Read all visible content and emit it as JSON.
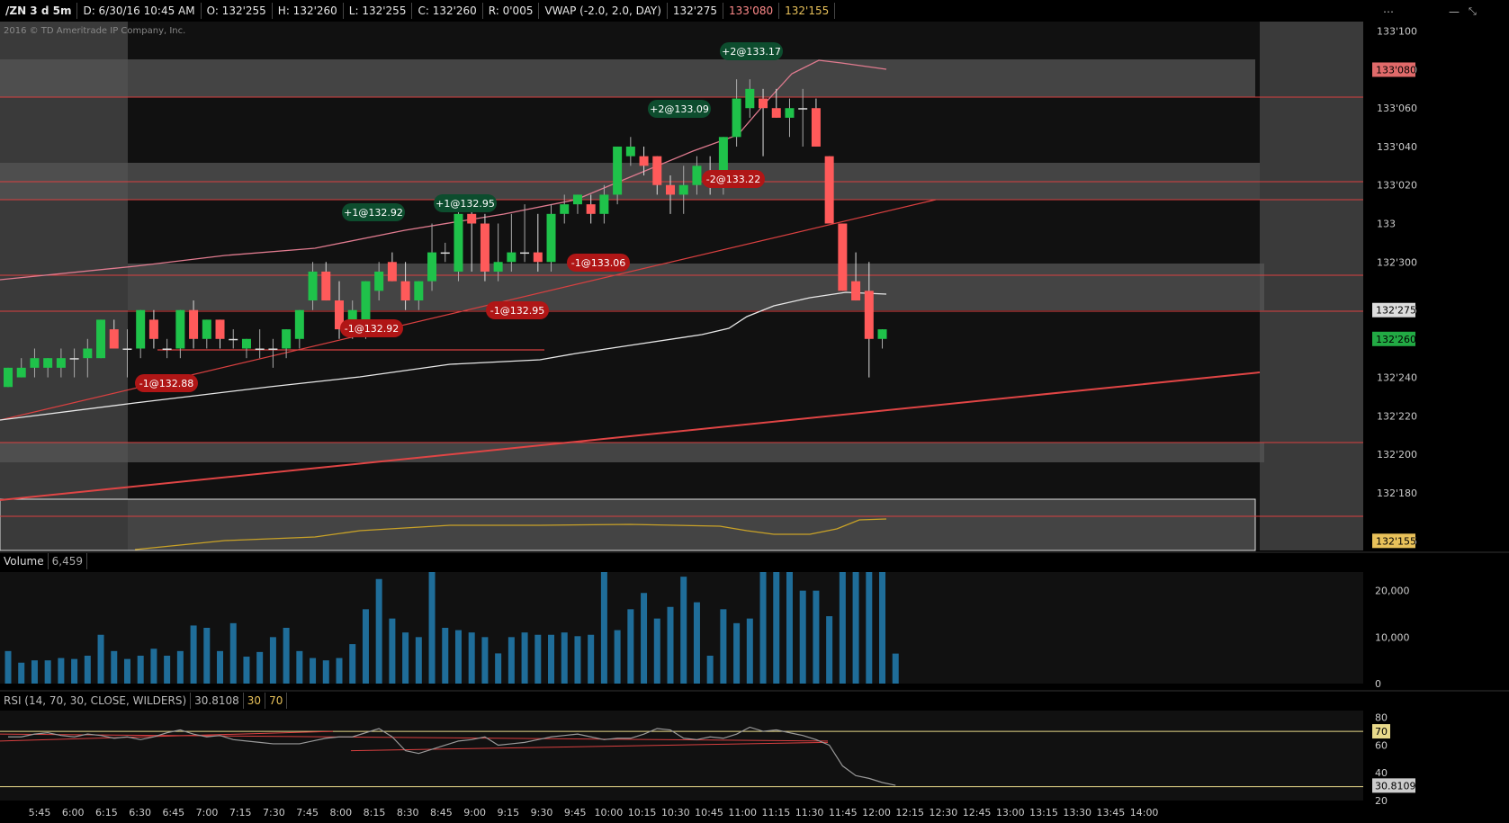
{
  "header": {
    "symbol": "/ZN 3 d 5m",
    "date": "D: 6/30/16 10:45 AM",
    "open": "O: 132'255",
    "high": "H: 132'260",
    "low": "L: 132'255",
    "close": "C: 132'260",
    "range": "R: 0'005",
    "vwap": "VWAP (-2.0, 2.0, DAY)",
    "vwap_mid": "132'275",
    "vwap_upper": "133'080",
    "vwap_lower": "132'155"
  },
  "copyright": "2016 © TD Ameritrade IP Company, Inc.",
  "chart_data": [
    {
      "type": "candlestick",
      "ylim": [
        132.15,
        133.105
      ],
      "price_axis_labels": [
        "133'100",
        "133'080",
        "133'060",
        "133'040",
        "133'020",
        "133",
        "132'300",
        "132'275",
        "132'240",
        "132'220",
        "132'200",
        "132'180",
        "132'155"
      ],
      "price_axis_values": [
        133.1,
        133.08,
        133.06,
        133.04,
        133.02,
        133.0,
        132.3,
        132.275,
        132.24,
        132.22,
        132.2,
        132.18,
        132.155
      ],
      "highlighted_price_labels": [
        {
          "label": "133'080",
          "value": 133.08,
          "color": "#e06a6a"
        },
        {
          "label": "132'275",
          "value": 132.275,
          "color": "#dddddd"
        },
        {
          "label": "132'260",
          "value": 132.26,
          "color": "#22aa44"
        },
        {
          "label": "132'155",
          "value": 132.155,
          "color": "#e8c15a"
        }
      ],
      "time_labels": [
        "5:45",
        "6:00",
        "6:15",
        "6:30",
        "6:45",
        "7:00",
        "7:15",
        "7:30",
        "7:45",
        "8:00",
        "8:15",
        "8:30",
        "8:45",
        "9:00",
        "9:15",
        "9:30",
        "9:45",
        "10:00",
        "10:15",
        "10:30",
        "10:45",
        "11:00",
        "11:15",
        "11:30",
        "11:45",
        "12:00",
        "12:15",
        "12:30",
        "12:45",
        "13:00",
        "13:15",
        "13:30",
        "13:45",
        "14:00"
      ],
      "candles": [
        [
          132.235,
          132.245,
          132.235,
          132.245
        ],
        [
          132.24,
          132.25,
          132.24,
          132.245
        ],
        [
          132.245,
          132.255,
          132.24,
          132.25
        ],
        [
          132.245,
          132.25,
          132.24,
          132.25
        ],
        [
          132.245,
          132.255,
          132.24,
          132.25
        ],
        [
          132.25,
          132.255,
          132.24,
          132.25
        ],
        [
          132.25,
          132.26,
          132.24,
          132.255
        ],
        [
          132.25,
          132.27,
          132.25,
          132.27
        ],
        [
          132.265,
          132.27,
          132.255,
          132.255
        ],
        [
          132.255,
          132.265,
          132.24,
          132.255
        ],
        [
          132.255,
          132.275,
          132.25,
          132.275
        ],
        [
          132.27,
          132.275,
          132.255,
          132.26
        ],
        [
          132.255,
          132.26,
          132.25,
          132.255
        ],
        [
          132.255,
          132.275,
          132.25,
          132.275
        ],
        [
          132.275,
          132.28,
          132.255,
          132.26
        ],
        [
          132.26,
          132.27,
          132.255,
          132.27
        ],
        [
          132.27,
          132.27,
          132.255,
          132.26
        ],
        [
          132.26,
          132.265,
          132.255,
          132.26
        ],
        [
          132.255,
          132.26,
          132.25,
          132.26
        ],
        [
          132.255,
          132.265,
          132.25,
          132.255
        ],
        [
          132.255,
          132.26,
          132.245,
          132.255
        ],
        [
          132.255,
          132.265,
          132.25,
          132.265
        ],
        [
          132.26,
          132.275,
          132.255,
          132.275
        ],
        [
          132.28,
          132.3,
          132.275,
          132.295
        ],
        [
          132.295,
          132.3,
          132.28,
          132.28
        ],
        [
          132.28,
          132.29,
          132.26,
          132.265
        ],
        [
          132.265,
          132.28,
          132.26,
          132.275
        ],
        [
          132.265,
          132.29,
          132.26,
          132.29
        ],
        [
          132.285,
          132.3,
          132.28,
          132.295
        ],
        [
          132.3,
          132.305,
          132.29,
          132.29
        ],
        [
          132.29,
          132.3,
          132.275,
          132.28
        ],
        [
          132.28,
          132.29,
          132.275,
          132.29
        ],
        [
          132.29,
          133.0,
          132.285,
          132.305
        ],
        [
          132.305,
          132.31,
          132.3,
          132.305
        ],
        [
          132.295,
          133.01,
          132.29,
          133.005
        ],
        [
          133.005,
          133.01,
          132.295,
          133.0
        ],
        [
          133.0,
          133.005,
          132.29,
          132.295
        ],
        [
          132.295,
          133.0,
          132.29,
          132.3
        ],
        [
          132.3,
          133.005,
          132.295,
          132.305
        ],
        [
          132.305,
          133.01,
          132.3,
          132.305
        ],
        [
          132.305,
          133.005,
          132.295,
          132.3
        ],
        [
          132.3,
          133.01,
          132.295,
          133.005
        ],
        [
          133.005,
          133.015,
          133.0,
          133.01
        ],
        [
          133.01,
          133.015,
          133.005,
          133.015
        ],
        [
          133.01,
          133.015,
          133.0,
          133.005
        ],
        [
          133.005,
          133.02,
          133.0,
          133.015
        ],
        [
          133.015,
          133.04,
          133.01,
          133.04
        ],
        [
          133.035,
          133.045,
          133.03,
          133.04
        ],
        [
          133.035,
          133.04,
          133.025,
          133.03
        ],
        [
          133.035,
          133.035,
          133.015,
          133.02
        ],
        [
          133.02,
          133.025,
          133.005,
          133.015
        ],
        [
          133.015,
          133.03,
          133.005,
          133.02
        ],
        [
          133.02,
          133.035,
          133.015,
          133.03
        ],
        [
          133.025,
          133.035,
          133.015,
          133.02
        ],
        [
          133.02,
          133.045,
          133.015,
          133.045
        ],
        [
          133.045,
          133.075,
          133.04,
          133.065
        ],
        [
          133.06,
          133.075,
          133.055,
          133.07
        ],
        [
          133.065,
          133.07,
          133.035,
          133.06
        ],
        [
          133.06,
          133.07,
          133.055,
          133.055
        ],
        [
          133.055,
          133.065,
          133.045,
          133.06
        ],
        [
          133.06,
          133.07,
          133.04,
          133.06
        ],
        [
          133.06,
          133.065,
          133.04,
          133.04
        ],
        [
          133.035,
          133.035,
          133.0,
          133.0
        ],
        [
          133.0,
          133.0,
          132.285,
          132.285
        ],
        [
          132.29,
          132.305,
          132.28,
          132.28
        ],
        [
          132.285,
          132.3,
          132.24,
          132.26
        ],
        [
          132.26,
          132.265,
          132.255,
          132.265
        ]
      ],
      "trades": [
        {
          "label": "-1@132.88",
          "side": "sell"
        },
        {
          "label": "-1@132.92",
          "side": "sell"
        },
        {
          "label": "+1@132.92",
          "side": "buy"
        },
        {
          "label": "+1@132.95",
          "side": "buy"
        },
        {
          "label": "-1@132.95",
          "side": "sell"
        },
        {
          "label": "-1@133.06",
          "side": "sell"
        },
        {
          "label": "+2@133.09",
          "side": "buy"
        },
        {
          "label": "-2@133.22",
          "side": "sell"
        },
        {
          "label": "+2@133.17",
          "side": "buy"
        }
      ]
    },
    {
      "type": "bar",
      "title": "Volume",
      "last_value": "6,459",
      "ylim": [
        0,
        24000
      ],
      "axis_labels": [
        "20,000",
        "10,000",
        "0"
      ],
      "values": [
        7000,
        4500,
        5000,
        5000,
        5500,
        5300,
        6000,
        10500,
        7000,
        5300,
        6000,
        7500,
        6000,
        7000,
        12500,
        12000,
        7000,
        13000,
        5800,
        6800,
        10000,
        12000,
        7000,
        5500,
        5000,
        5500,
        8500,
        16000,
        22500,
        14000,
        11000,
        10000,
        24000,
        12000,
        11500,
        11000,
        10000,
        6500,
        10000,
        11000,
        10500,
        10500,
        11000,
        10200,
        10500,
        24000,
        11500,
        16000,
        19500,
        14000,
        16500,
        23000,
        17500,
        6000,
        16000,
        13000,
        14000,
        24000,
        24000,
        24000,
        20000,
        20000,
        14500,
        24000,
        24000,
        24000,
        24000,
        6459
      ]
    },
    {
      "type": "line",
      "title": "RSI (14, 70, 30, CLOSE, WILDERS)",
      "last_value": "30.8108",
      "levels": [
        "30",
        "70"
      ],
      "ylim": [
        20,
        85
      ],
      "axis_labels": [
        "80",
        "70",
        "60",
        "40",
        "30.8109",
        "20"
      ],
      "values": [
        66,
        66,
        68,
        69,
        67,
        66,
        68,
        67,
        65,
        66,
        64,
        66,
        69,
        71,
        68,
        66,
        67,
        64,
        63,
        62,
        61,
        61,
        61,
        63,
        65,
        66,
        66,
        69,
        72,
        66,
        56,
        54,
        57,
        60,
        63,
        64,
        66,
        60,
        61,
        62,
        64,
        66,
        67,
        68,
        66,
        64,
        65,
        65,
        68,
        72,
        71,
        65,
        64,
        66,
        65,
        68,
        73,
        70,
        71,
        69,
        67,
        64,
        60,
        45,
        38,
        36,
        33,
        31
      ]
    }
  ],
  "colors": {
    "up": "#1fc24a",
    "down": "#ff5a5a",
    "vwap_mid": "#e8e8e8",
    "vwap_upper": "#e07b8f",
    "vwap_lower": "#c9a227",
    "volume": "#1f6d99",
    "buy_tag": "#0d4d2e",
    "sell_tag": "#b01616"
  }
}
